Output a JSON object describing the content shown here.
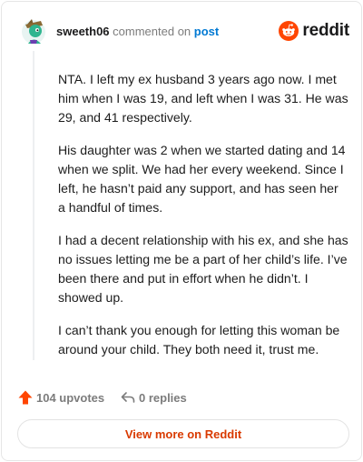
{
  "comment": {
    "author": "sweeth06",
    "commented_text": "commented on",
    "post_link": "post",
    "paragraphs": [
      "NTA. I left my ex husband 3 years ago now. I met him when I was 19, and left when I was 31. He was 29, and 41 respectively.",
      "His daughter was 2 when we started dating and 14 when we split. We had her every weekend. Since I left, he hasn’t paid any support, and has seen her a handful of times.",
      "I had a decent relationship with his ex, and she has no issues letting me be a part of her child’s life. I’ve been there and put in effort when he didn’t. I showed up.",
      "I can’t thank you enough for letting this woman be around your child. They both need it, trust me."
    ]
  },
  "brand": {
    "wordmark": "reddit",
    "icon": "reddit-snoo-icon"
  },
  "actions": {
    "upvotes_label": "104 upvotes",
    "replies_label": "0 replies",
    "upvote_icon": "upvote-arrow-icon",
    "reply_icon": "reply-arrow-icon"
  },
  "footer": {
    "view_more_label": "View more on Reddit"
  },
  "colors": {
    "brand_orange": "#ff4500",
    "link_blue": "#0079d3",
    "view_more_text": "#d93a00",
    "muted_text": "#7c7c7c"
  }
}
